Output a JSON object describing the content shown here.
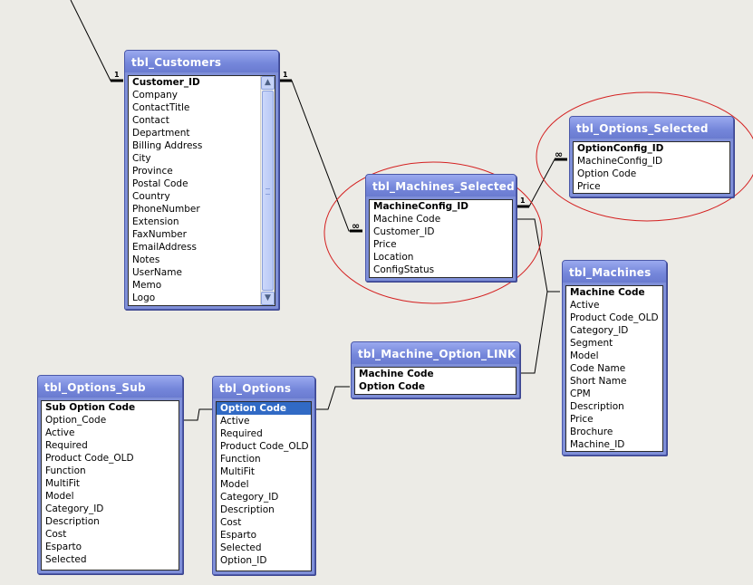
{
  "tables": {
    "customers": {
      "title": "tbl_Customers",
      "fields": [
        "Customer_ID",
        "Company",
        "ContactTitle",
        "Contact",
        "Department",
        "Billing Address",
        "City",
        "Province",
        "Postal Code",
        "Country",
        "PhoneNumber",
        "Extension",
        "FaxNumber",
        "EmailAddress",
        "Notes",
        "UserName",
        "Memo",
        "Logo"
      ]
    },
    "machines_selected": {
      "title": "tbl_Machines_Selected",
      "fields": [
        "MachineConfig_ID",
        "Machine Code",
        "Customer_ID",
        "Price",
        "Location",
        "ConfigStatus"
      ]
    },
    "options_selected": {
      "title": "tbl_Options_Selected",
      "fields": [
        "OptionConfig_ID",
        "MachineConfig_ID",
        "Option Code",
        "Price"
      ]
    },
    "machines": {
      "title": "tbl_Machines",
      "fields": [
        "Machine Code",
        "Active",
        "Product Code_OLD",
        "Category_ID",
        "Segment",
        "Model",
        "Code Name",
        "Short Name",
        "CPM",
        "Description",
        "Price",
        "Brochure",
        "Machine_ID"
      ]
    },
    "machine_option_link": {
      "title": "tbl_Machine_Option_LINK",
      "fields": [
        "Machine Code",
        "Option Code"
      ]
    },
    "options": {
      "title": "tbl_Options",
      "fields": [
        "Option Code",
        "Active",
        "Required",
        "Product Code_OLD",
        "Function",
        "MultiFit",
        "Model",
        "Category_ID",
        "Description",
        "Cost",
        "Esparto",
        "Selected",
        "Option_ID"
      ]
    },
    "options_sub": {
      "title": "tbl_Options_Sub",
      "fields": [
        "Sub Option Code",
        "Option_Code",
        "Active",
        "Required",
        "Product Code_OLD",
        "Function",
        "MultiFit",
        "Model",
        "Category_ID",
        "Description",
        "Cost",
        "Esparto",
        "Selected"
      ]
    }
  },
  "cardinality": {
    "one": "1",
    "many": "∞"
  },
  "highlight_color": "#d42020"
}
